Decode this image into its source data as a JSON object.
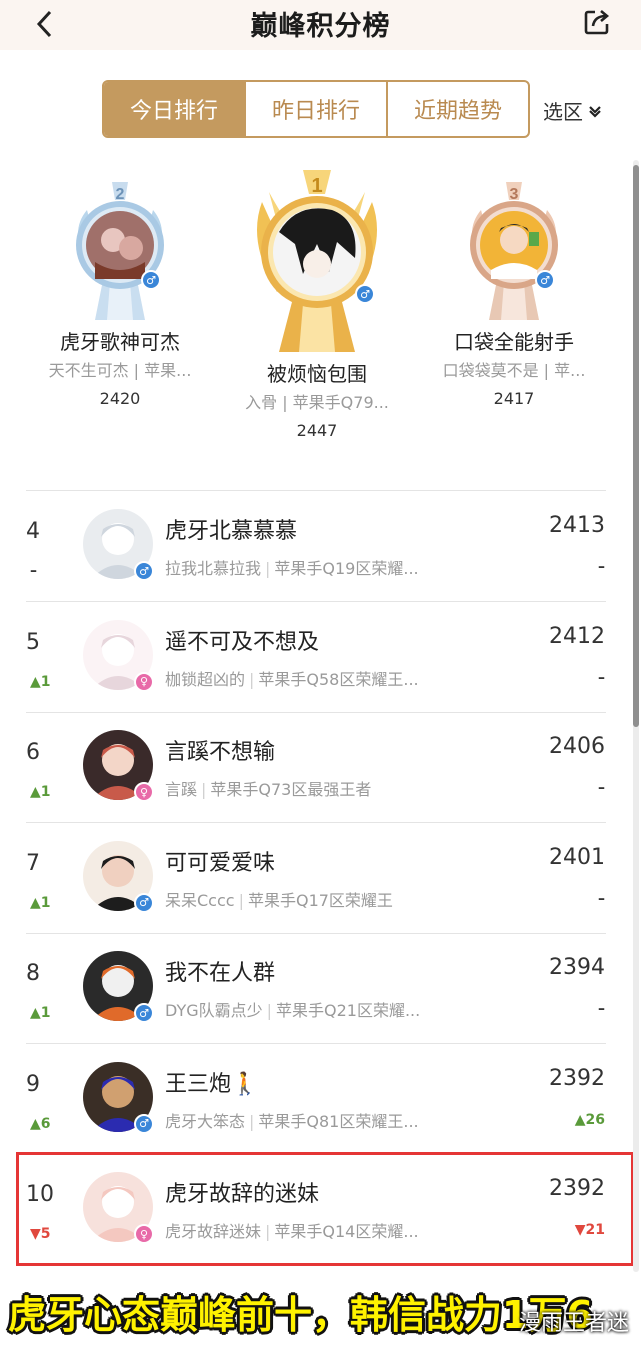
{
  "header": {
    "title": "巅峰积分榜"
  },
  "tabs": [
    {
      "label": "今日排行",
      "active": true
    },
    {
      "label": "昨日排行",
      "active": false
    },
    {
      "label": "近期趋势",
      "active": false
    }
  ],
  "region": {
    "label": "选区"
  },
  "podium": [
    {
      "rank": "2",
      "name": "虎牙歌神可杰",
      "sub": "天不生可杰 | 苹果...",
      "score": "2420",
      "gender": "male"
    },
    {
      "rank": "1",
      "name": "被烦恼包围",
      "sub": "入骨 | 苹果手Q79...",
      "score": "2447",
      "gender": "male"
    },
    {
      "rank": "3",
      "name": "口袋全能射手",
      "sub": "口袋袋莫不是 | 苹...",
      "score": "2417",
      "gender": "male"
    }
  ],
  "rows": [
    {
      "rank": "4",
      "change": "–",
      "change_dir": "flat",
      "name": "虎牙北慕慕慕",
      "nick": "拉我北慕拉我",
      "server": "苹果手Q19区荣耀...",
      "score": "2413",
      "score_change": "–",
      "score_dir": "flat",
      "gender": "male"
    },
    {
      "rank": "5",
      "change": "▲1",
      "change_dir": "up",
      "name": "遥不可及不想及",
      "nick": "枷锁超凶的",
      "server": "苹果手Q58区荣耀王...",
      "score": "2412",
      "score_change": "–",
      "score_dir": "flat",
      "gender": "female"
    },
    {
      "rank": "6",
      "change": "▲1",
      "change_dir": "up",
      "name": "言蹊不想输",
      "nick": "言蹊",
      "server": "苹果手Q73区最强王者",
      "score": "2406",
      "score_change": "–",
      "score_dir": "flat",
      "gender": "female"
    },
    {
      "rank": "7",
      "change": "▲1",
      "change_dir": "up",
      "name": "可可爱爱味",
      "nick": "呆呆Cccc",
      "server": "苹果手Q17区荣耀王",
      "score": "2401",
      "score_change": "–",
      "score_dir": "flat",
      "gender": "male"
    },
    {
      "rank": "8",
      "change": "▲1",
      "change_dir": "up",
      "name": "我不在人群",
      "nick": "DYG队霸点少",
      "server": "苹果手Q21区荣耀...",
      "score": "2394",
      "score_change": "–",
      "score_dir": "flat",
      "gender": "male"
    },
    {
      "rank": "9",
      "change": "▲6",
      "change_dir": "up",
      "name": "王三炮🚶",
      "nick": "虎牙大笨态",
      "server": "苹果手Q81区荣耀王...",
      "score": "2392",
      "score_change": "▲26",
      "score_dir": "up",
      "gender": "male"
    },
    {
      "rank": "10",
      "change": "▼5",
      "change_dir": "down",
      "name": "虎牙故辞的迷妹",
      "nick": "虎牙故辞迷妹",
      "server": "苹果手Q14区荣耀...",
      "score": "2392",
      "score_change": "▼21",
      "score_dir": "down",
      "gender": "female"
    }
  ],
  "caption": {
    "part1": "虎牙心态巅峰前十，韩信战力1万6",
    "watermark": "漫雨王者迷"
  }
}
